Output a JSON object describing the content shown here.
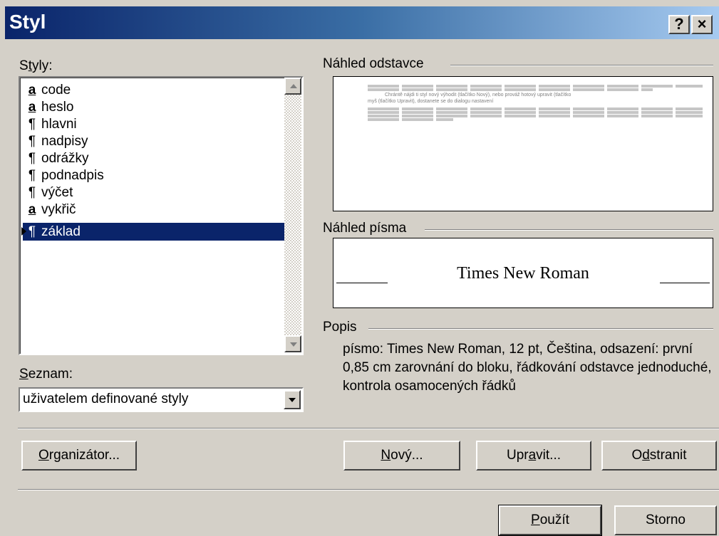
{
  "window": {
    "title": "Styl",
    "help_button": "?",
    "close_button": "×"
  },
  "styles_panel": {
    "label_pre": "S",
    "label_key": "t",
    "label_post": "yly:",
    "items": [
      {
        "mark": "a",
        "type": "character",
        "label": "code"
      },
      {
        "mark": "a",
        "type": "character",
        "label": "heslo"
      },
      {
        "mark": "¶",
        "type": "paragraph",
        "label": "hlavni"
      },
      {
        "mark": "¶",
        "type": "paragraph",
        "label": "nadpisy"
      },
      {
        "mark": "¶",
        "type": "paragraph",
        "label": "odrážky"
      },
      {
        "mark": "¶",
        "type": "paragraph",
        "label": "podnadpis"
      },
      {
        "mark": "¶",
        "type": "paragraph",
        "label": "výčet"
      },
      {
        "mark": "a",
        "type": "character",
        "label": "vykřič"
      },
      {
        "mark": "¶",
        "type": "paragraph",
        "label": "základ",
        "selected": true
      }
    ]
  },
  "list_filter": {
    "label_key": "S",
    "label_post": "eznam:",
    "value": "uživatelem definované styly"
  },
  "paragraph_preview": {
    "label": "Náhled odstavce",
    "sample_line_1": "Chrántě nájdi ti styl nový výhodit (tlačítko Nový), nebo prováž hotový upravit (tlačítko",
    "sample_line_2": "myš (tlačítko Upravit), dostanete se do dialogu nastavení"
  },
  "font_preview": {
    "label": "Náhled písma",
    "sample": "Times New Roman"
  },
  "description": {
    "label": "Popis",
    "text": "písmo: Times New Roman, 12 pt, Čeština, odsazení: první  0,85 cm zarovnání do bloku, řádkování odstavce jednoduché, kontrola osamocených řádků"
  },
  "buttons": {
    "organizer": {
      "key": "O",
      "post": "rganizátor..."
    },
    "new": {
      "key": "N",
      "post": "ový..."
    },
    "modify": {
      "pre": "Upr",
      "key": "a",
      "post": "vit..."
    },
    "delete": {
      "pre": "O",
      "key": "d",
      "post": "stranit"
    },
    "apply": {
      "key": "P",
      "post": "oužít"
    },
    "cancel": {
      "label": "Storno"
    }
  }
}
